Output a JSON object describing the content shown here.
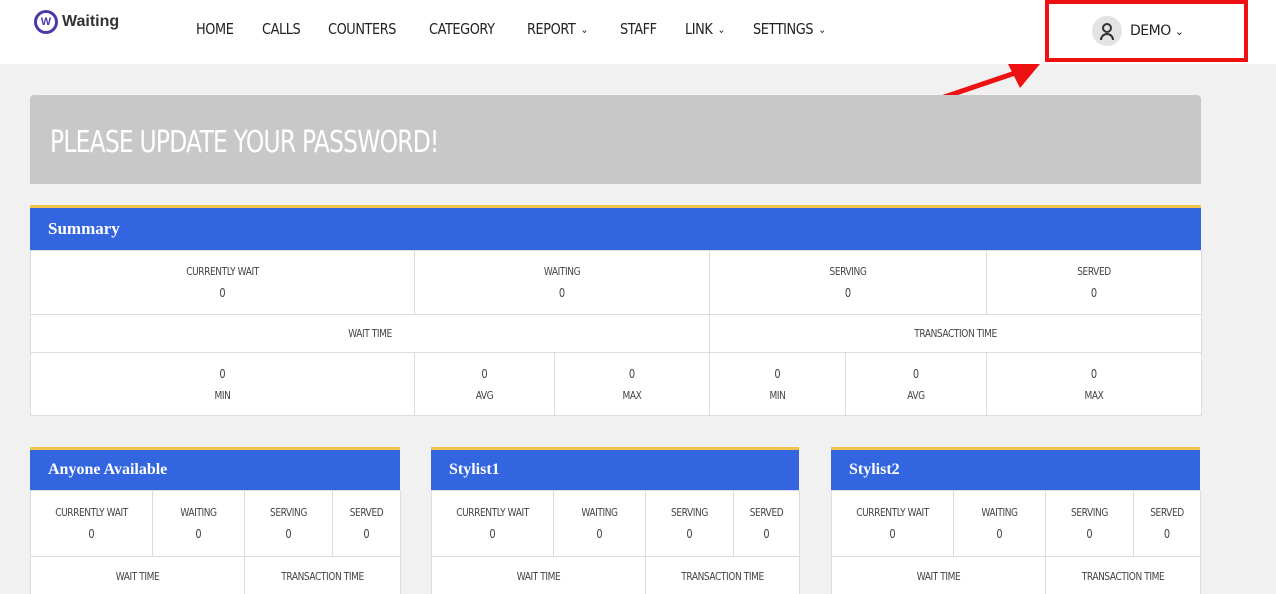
{
  "brand": {
    "logo_letter": "W",
    "name": "Waiting"
  },
  "nav": [
    {
      "label": "HOME",
      "dropdown": false
    },
    {
      "label": "CALLS",
      "dropdown": false
    },
    {
      "label": "COUNTERS",
      "dropdown": false
    },
    {
      "label": "CATEGORY",
      "dropdown": false
    },
    {
      "label": "REPORT",
      "dropdown": true
    },
    {
      "label": "STAFF",
      "dropdown": false
    },
    {
      "label": "LINK",
      "dropdown": true
    },
    {
      "label": "SETTINGS",
      "dropdown": true
    }
  ],
  "user": {
    "name": "DEMO",
    "icon": "user-icon"
  },
  "annotation": {
    "highlight_color": "#ee1111"
  },
  "banner": {
    "text": "PLEASE UPDATE YOUR PASSWORD!"
  },
  "summary": {
    "title": "Summary",
    "currently_wait_label": "CURRENTLY WAIT",
    "currently_wait": "0",
    "waiting_label": "WAITING",
    "waiting": "0",
    "serving_label": "SERVING",
    "serving": "0",
    "served_label": "SERVED",
    "served": "0",
    "wait_time_label": "WAIT TIME",
    "transaction_time_label": "TRANSACTION TIME",
    "wait_min": "0",
    "wait_avg": "0",
    "wait_max": "0",
    "trans_min": "0",
    "trans_avg": "0",
    "trans_max": "0",
    "min_label": "MIN",
    "avg_label": "AVG",
    "max_label": "MAX"
  },
  "categories": [
    {
      "title": "Anyone Available",
      "currently_wait": "0",
      "waiting": "0",
      "serving": "0",
      "served": "0"
    },
    {
      "title": "Stylist1",
      "currently_wait": "0",
      "waiting": "0",
      "serving": "0",
      "served": "0"
    },
    {
      "title": "Stylist2",
      "currently_wait": "0",
      "waiting": "0",
      "serving": "0",
      "served": "0"
    }
  ],
  "category_labels": {
    "currently_wait": "CURRENTLY WAIT",
    "waiting": "WAITING",
    "serving": "SERVING",
    "served": "SERVED",
    "wait_time": "WAIT TIME",
    "transaction_time": "TRANSACTION TIME"
  },
  "colors": {
    "accent": "#3365e0",
    "accent_border": "#f0c34a",
    "banner": "#c8c8c8"
  }
}
